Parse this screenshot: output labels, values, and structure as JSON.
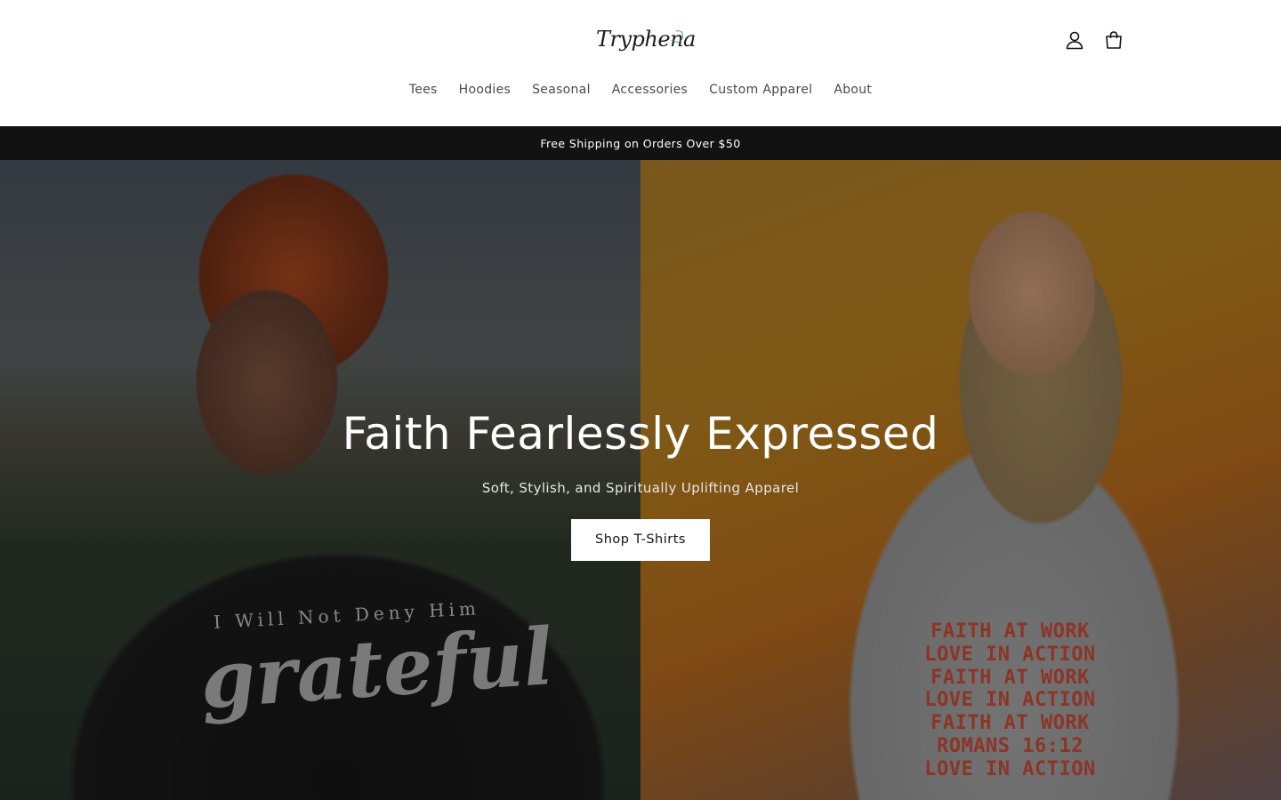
{
  "header": {
    "logo_text": "Tryphena",
    "icons": {
      "account": "account-icon",
      "cart": "cart-icon"
    }
  },
  "nav": {
    "items": [
      {
        "label": "Tees"
      },
      {
        "label": "Hoodies"
      },
      {
        "label": "Seasonal"
      },
      {
        "label": "Accessories"
      },
      {
        "label": "Custom Apparel"
      },
      {
        "label": "About"
      }
    ]
  },
  "announcement": {
    "text": "Free Shipping on Orders Over $50"
  },
  "hero": {
    "title": "Faith Fearlessly Expressed",
    "subtitle": "Soft, Stylish, and Spiritually Uplifting Apparel",
    "button_label": "Shop T-Shirts",
    "left_shirt": {
      "line1": "I Will Not Deny Him",
      "line2": "grateful"
    },
    "right_shirt": {
      "lines": [
        "FAITH AT WORK",
        "LOVE IN ACTION",
        "FAITH AT WORK",
        "LOVE IN ACTION",
        "FAITH AT WORK",
        "ROMANS 16:12",
        "LOVE IN ACTION"
      ]
    }
  },
  "colors": {
    "announcement_bg": "#121212",
    "shirt_print_red": "#c24a36",
    "logo_accent": "#3aa39a"
  }
}
